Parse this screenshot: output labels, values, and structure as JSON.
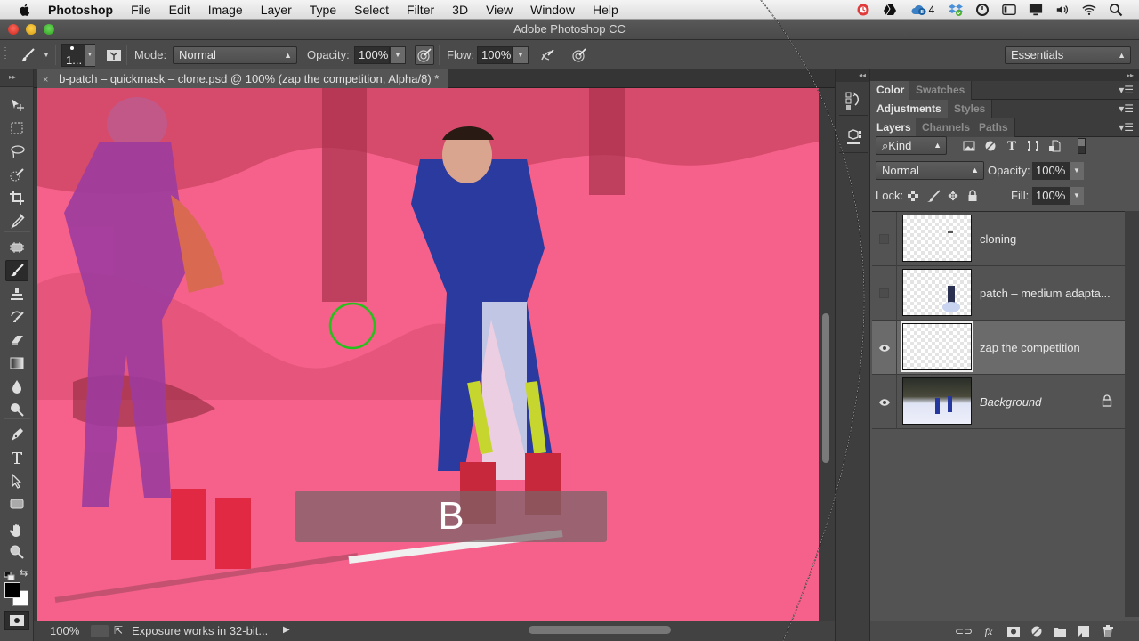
{
  "menubar": {
    "app_name": "Photoshop",
    "items": [
      "File",
      "Edit",
      "Image",
      "Layer",
      "Type",
      "Select",
      "Filter",
      "3D",
      "View",
      "Window",
      "Help"
    ],
    "status_icons": [
      "creative-cloud-sync-icon",
      "google-drive-icon",
      "creative-cloud-icon",
      "dropbox-icon",
      "time-machine-icon",
      "window-icon",
      "display-icon",
      "volume-icon",
      "wifi-icon",
      "spotlight-search-icon"
    ],
    "cc_badge_count": "4"
  },
  "window": {
    "title": "Adobe Photoshop CC"
  },
  "options_bar": {
    "brush_size": "1...",
    "mode_label": "Mode:",
    "mode_value": "Normal",
    "opacity_label": "Opacity:",
    "opacity_value": "100%",
    "flow_label": "Flow:",
    "flow_value": "100%",
    "workspace": "Essentials"
  },
  "document": {
    "tab_title": "b-patch – quickmask – clone.psd @ 100% (zap the competition, Alpha/8) *",
    "close_glyph": "×",
    "overlay_key": "B",
    "quickmask_color": "#f2587a"
  },
  "toolbar": {
    "tools": [
      {
        "name": "move-tool",
        "active": false
      },
      {
        "name": "marquee-tool",
        "active": false
      },
      {
        "name": "lasso-tool",
        "active": false
      },
      {
        "name": "quick-selection-tool",
        "active": false
      },
      {
        "name": "crop-tool",
        "active": false
      },
      {
        "name": "eyedropper-tool",
        "active": false
      },
      {
        "name": "spot-healing-tool",
        "active": false
      },
      {
        "name": "brush-tool",
        "active": true
      },
      {
        "name": "clone-stamp-tool",
        "active": false
      },
      {
        "name": "history-brush-tool",
        "active": false
      },
      {
        "name": "eraser-tool",
        "active": false
      },
      {
        "name": "gradient-tool",
        "active": false
      },
      {
        "name": "blur-tool",
        "active": false
      },
      {
        "name": "dodge-tool",
        "active": false
      },
      {
        "name": "pen-tool",
        "active": false
      },
      {
        "name": "type-tool",
        "active": false
      },
      {
        "name": "path-selection-tool",
        "active": false
      },
      {
        "name": "rectangle-tool",
        "active": false
      },
      {
        "name": "hand-tool",
        "active": false
      },
      {
        "name": "zoom-tool",
        "active": false
      }
    ],
    "foreground_color": "#000000",
    "background_color": "#ffffff"
  },
  "status_bar": {
    "zoom": "100%",
    "message": "Exposure works in 32-bit..."
  },
  "panels": {
    "color_group": {
      "tabs": [
        "Color",
        "Swatches"
      ],
      "active": 0
    },
    "adjustments_group": {
      "tabs": [
        "Adjustments",
        "Styles"
      ],
      "active": 0
    },
    "layers_group": {
      "tabs": [
        "Layers",
        "Channels",
        "Paths"
      ],
      "active": 0
    },
    "layers": {
      "filter_kind": "Kind",
      "blend_mode": "Normal",
      "opacity_label": "Opacity:",
      "opacity_value": "100%",
      "lock_label": "Lock:",
      "fill_label": "Fill:",
      "fill_value": "100%",
      "items": [
        {
          "name": "cloning",
          "visible": false,
          "selected": false,
          "italic": false,
          "locked": false
        },
        {
          "name": "patch – medium adapta...",
          "visible": false,
          "selected": false,
          "italic": false,
          "locked": false
        },
        {
          "name": "zap the competition",
          "visible": true,
          "selected": true,
          "italic": false,
          "locked": false
        },
        {
          "name": "Background",
          "visible": true,
          "selected": false,
          "italic": true,
          "locked": true
        }
      ]
    }
  }
}
